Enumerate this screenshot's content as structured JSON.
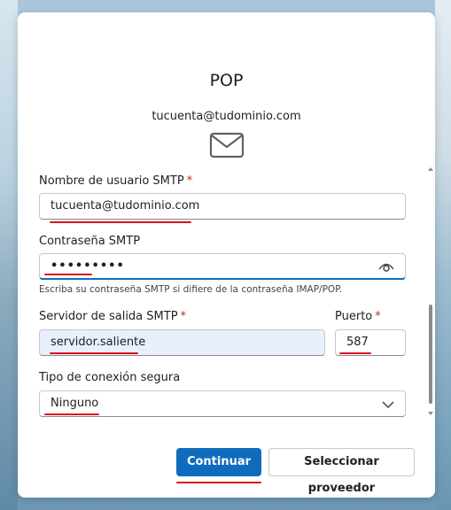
{
  "dialog": {
    "title": "POP",
    "account_email": "tucuenta@tudominio.com",
    "icon": "mail-icon"
  },
  "smtp_username": {
    "label": "Nombre de usuario SMTP",
    "required_mark": "*",
    "value": "tucuenta@tudominio.com"
  },
  "smtp_password": {
    "label": "Contraseña SMTP",
    "value": "•••••••••",
    "hint": "Escriba su contraseña SMTP si difiere de la contraseña IMAP/POP.",
    "icon": "eye-icon"
  },
  "outgoing_server": {
    "label": "Servidor de salida SMTP",
    "required_mark": "*",
    "value": "servidor.saliente"
  },
  "port": {
    "label": "Puerto",
    "required_mark": "*",
    "value": "587"
  },
  "secure_connection": {
    "label": "Tipo de conexión segura",
    "selected": "Ninguno",
    "icon": "chevron-down-icon"
  },
  "buttons": {
    "continue_label": "Continuar",
    "select_provider_label": "Seleccionar proveedor"
  },
  "colors": {
    "accent": "#0f6cbd",
    "required": "#c42b1c",
    "annotation_underline": "#d8141c"
  }
}
